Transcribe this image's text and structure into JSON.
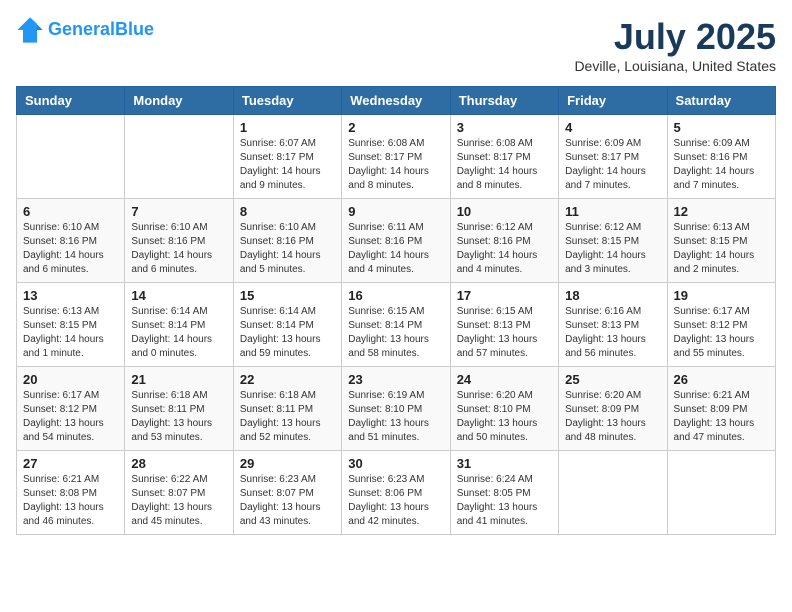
{
  "header": {
    "logo_line1": "General",
    "logo_line2": "Blue",
    "month": "July 2025",
    "location": "Deville, Louisiana, United States"
  },
  "weekdays": [
    "Sunday",
    "Monday",
    "Tuesday",
    "Wednesday",
    "Thursday",
    "Friday",
    "Saturday"
  ],
  "weeks": [
    [
      {
        "day": "",
        "info": ""
      },
      {
        "day": "",
        "info": ""
      },
      {
        "day": "1",
        "info": "Sunrise: 6:07 AM\nSunset: 8:17 PM\nDaylight: 14 hours and 9 minutes."
      },
      {
        "day": "2",
        "info": "Sunrise: 6:08 AM\nSunset: 8:17 PM\nDaylight: 14 hours and 8 minutes."
      },
      {
        "day": "3",
        "info": "Sunrise: 6:08 AM\nSunset: 8:17 PM\nDaylight: 14 hours and 8 minutes."
      },
      {
        "day": "4",
        "info": "Sunrise: 6:09 AM\nSunset: 8:17 PM\nDaylight: 14 hours and 7 minutes."
      },
      {
        "day": "5",
        "info": "Sunrise: 6:09 AM\nSunset: 8:16 PM\nDaylight: 14 hours and 7 minutes."
      }
    ],
    [
      {
        "day": "6",
        "info": "Sunrise: 6:10 AM\nSunset: 8:16 PM\nDaylight: 14 hours and 6 minutes."
      },
      {
        "day": "7",
        "info": "Sunrise: 6:10 AM\nSunset: 8:16 PM\nDaylight: 14 hours and 6 minutes."
      },
      {
        "day": "8",
        "info": "Sunrise: 6:10 AM\nSunset: 8:16 PM\nDaylight: 14 hours and 5 minutes."
      },
      {
        "day": "9",
        "info": "Sunrise: 6:11 AM\nSunset: 8:16 PM\nDaylight: 14 hours and 4 minutes."
      },
      {
        "day": "10",
        "info": "Sunrise: 6:12 AM\nSunset: 8:16 PM\nDaylight: 14 hours and 4 minutes."
      },
      {
        "day": "11",
        "info": "Sunrise: 6:12 AM\nSunset: 8:15 PM\nDaylight: 14 hours and 3 minutes."
      },
      {
        "day": "12",
        "info": "Sunrise: 6:13 AM\nSunset: 8:15 PM\nDaylight: 14 hours and 2 minutes."
      }
    ],
    [
      {
        "day": "13",
        "info": "Sunrise: 6:13 AM\nSunset: 8:15 PM\nDaylight: 14 hours and 1 minute."
      },
      {
        "day": "14",
        "info": "Sunrise: 6:14 AM\nSunset: 8:14 PM\nDaylight: 14 hours and 0 minutes."
      },
      {
        "day": "15",
        "info": "Sunrise: 6:14 AM\nSunset: 8:14 PM\nDaylight: 13 hours and 59 minutes."
      },
      {
        "day": "16",
        "info": "Sunrise: 6:15 AM\nSunset: 8:14 PM\nDaylight: 13 hours and 58 minutes."
      },
      {
        "day": "17",
        "info": "Sunrise: 6:15 AM\nSunset: 8:13 PM\nDaylight: 13 hours and 57 minutes."
      },
      {
        "day": "18",
        "info": "Sunrise: 6:16 AM\nSunset: 8:13 PM\nDaylight: 13 hours and 56 minutes."
      },
      {
        "day": "19",
        "info": "Sunrise: 6:17 AM\nSunset: 8:12 PM\nDaylight: 13 hours and 55 minutes."
      }
    ],
    [
      {
        "day": "20",
        "info": "Sunrise: 6:17 AM\nSunset: 8:12 PM\nDaylight: 13 hours and 54 minutes."
      },
      {
        "day": "21",
        "info": "Sunrise: 6:18 AM\nSunset: 8:11 PM\nDaylight: 13 hours and 53 minutes."
      },
      {
        "day": "22",
        "info": "Sunrise: 6:18 AM\nSunset: 8:11 PM\nDaylight: 13 hours and 52 minutes."
      },
      {
        "day": "23",
        "info": "Sunrise: 6:19 AM\nSunset: 8:10 PM\nDaylight: 13 hours and 51 minutes."
      },
      {
        "day": "24",
        "info": "Sunrise: 6:20 AM\nSunset: 8:10 PM\nDaylight: 13 hours and 50 minutes."
      },
      {
        "day": "25",
        "info": "Sunrise: 6:20 AM\nSunset: 8:09 PM\nDaylight: 13 hours and 48 minutes."
      },
      {
        "day": "26",
        "info": "Sunrise: 6:21 AM\nSunset: 8:09 PM\nDaylight: 13 hours and 47 minutes."
      }
    ],
    [
      {
        "day": "27",
        "info": "Sunrise: 6:21 AM\nSunset: 8:08 PM\nDaylight: 13 hours and 46 minutes."
      },
      {
        "day": "28",
        "info": "Sunrise: 6:22 AM\nSunset: 8:07 PM\nDaylight: 13 hours and 45 minutes."
      },
      {
        "day": "29",
        "info": "Sunrise: 6:23 AM\nSunset: 8:07 PM\nDaylight: 13 hours and 43 minutes."
      },
      {
        "day": "30",
        "info": "Sunrise: 6:23 AM\nSunset: 8:06 PM\nDaylight: 13 hours and 42 minutes."
      },
      {
        "day": "31",
        "info": "Sunrise: 6:24 AM\nSunset: 8:05 PM\nDaylight: 13 hours and 41 minutes."
      },
      {
        "day": "",
        "info": ""
      },
      {
        "day": "",
        "info": ""
      }
    ]
  ]
}
